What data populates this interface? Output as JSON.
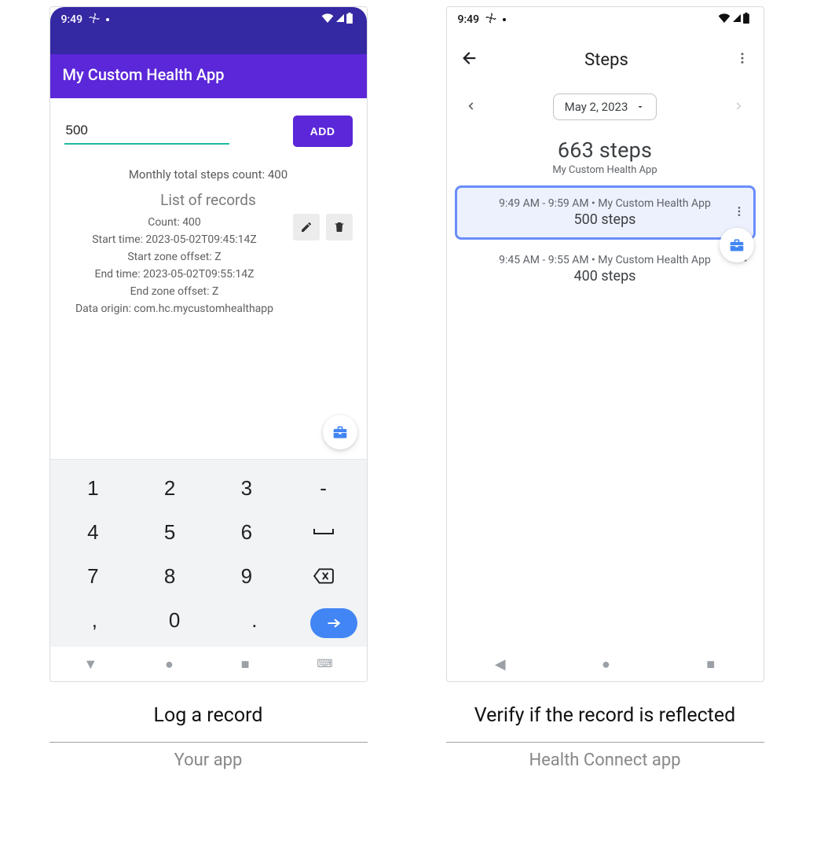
{
  "status": {
    "time": "9:49"
  },
  "left": {
    "appbar_title": "My Custom Health App",
    "input_value": "500",
    "add_label": "ADD",
    "monthly_text": "Monthly total steps count: 400",
    "records_header": "List of records",
    "record": {
      "count": "Count: 400",
      "start_time": "Start time: 2023-05-02T09:45:14Z",
      "start_zone": "Start zone offset: Z",
      "end_time": "End time: 2023-05-02T09:55:14Z",
      "end_zone": "End zone offset: Z",
      "data_origin": "Data origin: com.hc.mycustomhealthapp"
    },
    "keyboard": {
      "r1": [
        "1",
        "2",
        "3",
        "-"
      ],
      "r2": [
        "4",
        "5",
        "6",
        "␣"
      ],
      "r3": [
        "7",
        "8",
        "9",
        "⌫"
      ],
      "r4": [
        ",",
        "0",
        ".",
        "→"
      ]
    }
  },
  "right": {
    "title": "Steps",
    "date_chip": "May 2, 2023",
    "summary_value": "663 steps",
    "summary_source": "My Custom Health App",
    "entries": [
      {
        "meta": "9:49 AM - 9:59 AM • My Custom Health App",
        "value": "500 steps",
        "highlight": true
      },
      {
        "meta": "9:45 AM - 9:55 AM • My Custom Health App",
        "value": "400 steps",
        "highlight": false
      }
    ]
  },
  "captions": {
    "left_top": "Log a record",
    "left_bottom": "Your app",
    "right_top": "Verify if the record is reflected",
    "right_bottom": "Health Connect app"
  }
}
